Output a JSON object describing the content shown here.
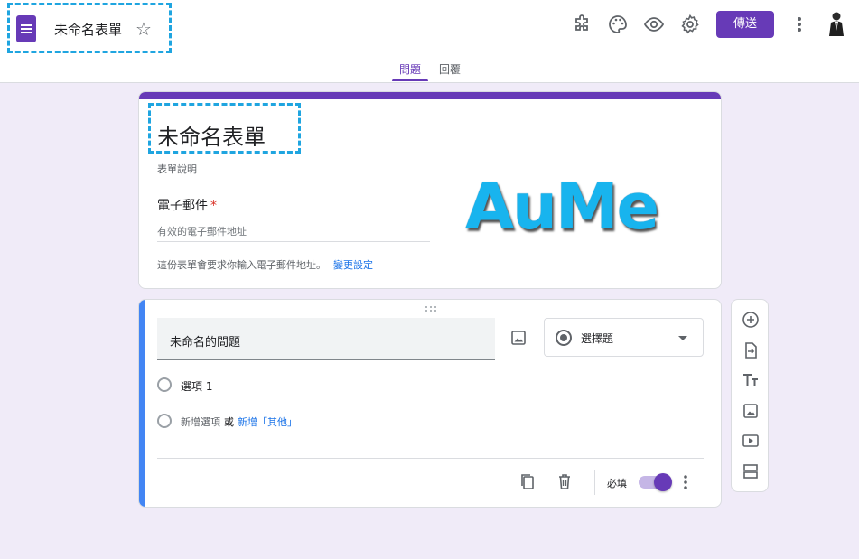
{
  "app": {
    "title": "未命名表單",
    "send_label": "傳送"
  },
  "tabs": [
    {
      "label": "問題",
      "active": true
    },
    {
      "label": "回覆",
      "active": false
    }
  ],
  "form_header": {
    "title": "未命名表單",
    "description_placeholder": "表單說明",
    "email_label": "電子郵件",
    "email_required_mark": "*",
    "email_placeholder": "有效的電子郵件地址",
    "email_note": "這份表單會要求你輸入電子郵件地址。",
    "email_note_link": "變更設定"
  },
  "watermark": "AuMe",
  "question": {
    "title": "未命名的問題",
    "type_label": "選擇題",
    "options": [
      "選項 1"
    ],
    "add_option": "新增選項",
    "or": "或",
    "add_other": "新增「其他」",
    "required_label": "必填",
    "required_on": true
  },
  "colors": {
    "accent": "#673ab7",
    "canvas": "#f0ebf8",
    "active_question_bar": "#4285f4",
    "link": "#1a73e8",
    "highlight_box": "#1fa5e0"
  },
  "icons": {
    "top_toolbar": [
      "addon-puzzle-icon",
      "palette-icon",
      "preview-eye-icon",
      "settings-gear-icon",
      "more-vert-icon",
      "avatar"
    ],
    "side_toolbar": [
      "add-question-icon",
      "import-questions-icon",
      "add-title-text-icon",
      "add-image-icon",
      "add-video-icon",
      "add-section-icon"
    ],
    "question_footer": [
      "duplicate-icon",
      "delete-icon",
      "more-vert-icon"
    ]
  }
}
